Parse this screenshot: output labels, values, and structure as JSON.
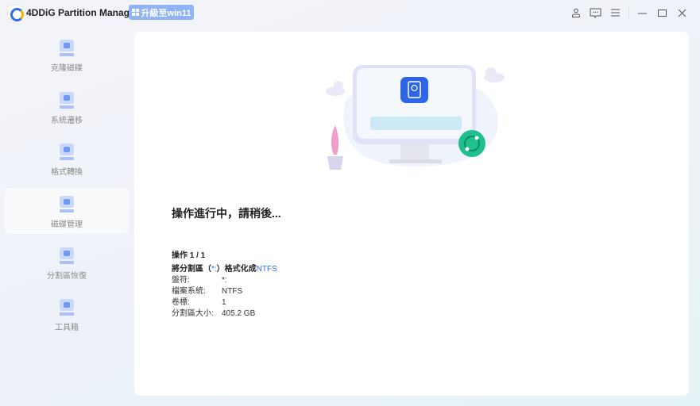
{
  "app": {
    "title": "4DDiG Partition Manager",
    "upgrade_label": "升級至win11"
  },
  "titlebar": {
    "icons": [
      "user-icon",
      "feedback-icon",
      "menu-icon",
      "minimize-icon",
      "maximize-icon",
      "close-icon"
    ]
  },
  "sidebar": {
    "items": [
      {
        "label": "克隆磁碟",
        "active": false
      },
      {
        "label": "系統遷移",
        "active": false
      },
      {
        "label": "格式轉換",
        "active": false
      },
      {
        "label": "磁碟管理",
        "active": true
      },
      {
        "label": "分割區恢復",
        "active": false
      },
      {
        "label": "工具箱",
        "active": false
      }
    ]
  },
  "main": {
    "heading": "操作進行中，請稍後...",
    "operation": "操作 1 / 1",
    "desc": {
      "prefix": "將分割區（",
      "drive": "*:",
      "mid": "）格式化成",
      "fs": "NTFS"
    },
    "details": [
      {
        "key": "盤符:",
        "value": "*:"
      },
      {
        "key": "檔案系統:",
        "value": "NTFS"
      },
      {
        "key": "卷標:",
        "value": "1"
      },
      {
        "key": "分割區大小:",
        "value": "405.2 GB"
      }
    ]
  },
  "colors": {
    "accent": "#2f6de8",
    "progress_icon": "#1fbf8f"
  }
}
